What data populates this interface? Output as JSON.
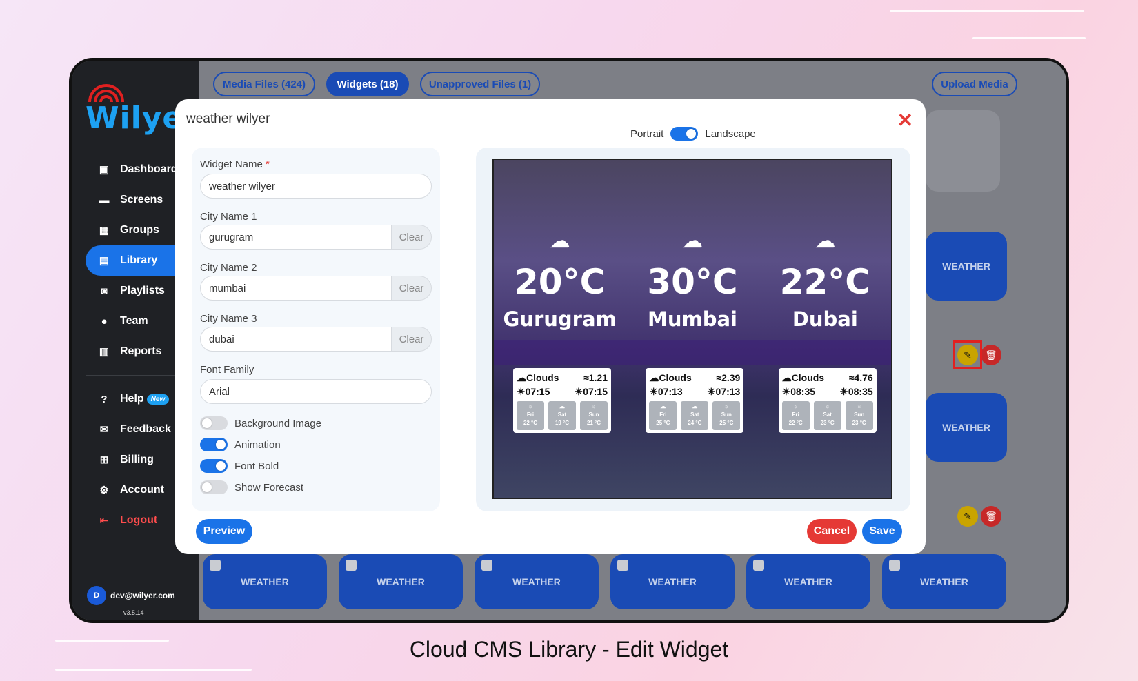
{
  "caption": "Cloud CMS Library - Edit Widget",
  "brand": {
    "name": "Wilye",
    "accent": "#1da1f2",
    "primary": "#1a73e8",
    "danger": "#e53935"
  },
  "sidebar": {
    "items": [
      {
        "label": "Dashboard",
        "icon": "dashboard-icon"
      },
      {
        "label": "Screens",
        "icon": "monitor-icon"
      },
      {
        "label": "Groups",
        "icon": "grid-icon"
      },
      {
        "label": "Library",
        "icon": "film-icon",
        "active": true
      },
      {
        "label": "Playlists",
        "icon": "camera-icon"
      },
      {
        "label": "Team",
        "icon": "team-icon"
      },
      {
        "label": "Reports",
        "icon": "clipboard-icon"
      }
    ],
    "secondary": [
      {
        "label": "Help",
        "badge": "New",
        "icon": "help-icon"
      },
      {
        "label": "Feedback",
        "icon": "feedback-icon"
      },
      {
        "label": "Billing",
        "icon": "cart-icon"
      },
      {
        "label": "Account",
        "icon": "gear-icon"
      },
      {
        "label": "Logout",
        "icon": "logout-icon"
      }
    ],
    "user": {
      "initial": "D",
      "email": "dev@wilyer.com"
    },
    "version": "v3.5.14"
  },
  "topbar": {
    "tabs": [
      "Media Files (424)",
      "Widgets (18)",
      "Unapproved Files (1)"
    ],
    "upload_label": "Upload Media"
  },
  "background": {
    "card_label": "WEATHER"
  },
  "modal": {
    "title": "weather wilyer",
    "orientation": {
      "left": "Portrait",
      "right": "Landscape"
    },
    "form": {
      "widget_name_label": "Widget Name",
      "widget_name_required": "*",
      "widget_name_value": "weather wilyer",
      "city1_label": "City Name 1",
      "city1_value": "gurugram",
      "city2_label": "City Name 2",
      "city2_value": "mumbai",
      "city3_label": "City Name 3",
      "city3_value": "dubai",
      "clear_label": "Clear",
      "font_family_label": "Font Family",
      "font_family_value": "Arial",
      "toggles": [
        {
          "label": "Background Image",
          "on": false
        },
        {
          "label": "Animation",
          "on": true
        },
        {
          "label": "Font Bold",
          "on": true
        },
        {
          "label": "Show Forecast",
          "on": false
        }
      ]
    },
    "preview": {
      "columns": [
        {
          "temp": "20°C",
          "city": "Gurugram",
          "condition": "Clouds",
          "wind": "1.21",
          "sunrise": "07:15",
          "sunset": "07:15",
          "forecast": [
            {
              "day": "Fri",
              "temp": "22 °C"
            },
            {
              "day": "Sat",
              "temp": "19 °C"
            },
            {
              "day": "Sun",
              "temp": "21 °C"
            }
          ]
        },
        {
          "temp": "30°C",
          "city": "Mumbai",
          "condition": "Clouds",
          "wind": "2.39",
          "sunrise": "07:13",
          "sunset": "07:13",
          "forecast": [
            {
              "day": "Fri",
              "temp": "25 °C"
            },
            {
              "day": "Sat",
              "temp": "24 °C"
            },
            {
              "day": "Sun",
              "temp": "25 °C"
            }
          ]
        },
        {
          "temp": "22°C",
          "city": "Dubai",
          "condition": "Clouds",
          "wind": "4.76",
          "sunrise": "08:35",
          "sunset": "08:35",
          "forecast": [
            {
              "day": "Fri",
              "temp": "22 °C"
            },
            {
              "day": "Sat",
              "temp": "23 °C"
            },
            {
              "day": "Sun",
              "temp": "23 °C"
            }
          ]
        }
      ]
    },
    "buttons": {
      "preview": "Preview",
      "cancel": "Cancel",
      "save": "Save"
    }
  }
}
